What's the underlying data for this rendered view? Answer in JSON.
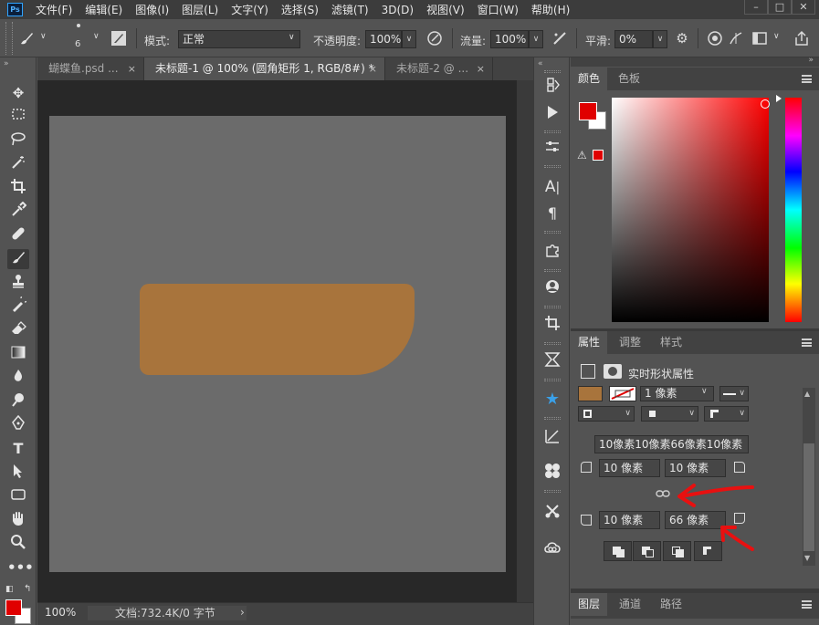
{
  "app": {
    "logo": "Ps"
  },
  "menu": [
    "文件(F)",
    "编辑(E)",
    "图像(I)",
    "图层(L)",
    "文字(Y)",
    "选择(S)",
    "滤镜(T)",
    "3D(D)",
    "视图(V)",
    "窗口(W)",
    "帮助(H)"
  ],
  "window_controls": {
    "minimize": "–",
    "maximize": "□",
    "close": "✕"
  },
  "options": {
    "brush_size": "6",
    "mode_label": "模式:",
    "mode_value": "正常",
    "opacity_label": "不透明度:",
    "opacity_value": "100%",
    "flow_label": "流量:",
    "flow_value": "100%",
    "smoothing_label": "平滑:",
    "smoothing_value": "0%"
  },
  "tabs": [
    {
      "label": "蝴蝶鱼.psd ...",
      "close": "×"
    },
    {
      "label": "未标题-1 @ 100% (圆角矩形 1, RGB/8#) *",
      "close": "×"
    },
    {
      "label": "未标题-2 @ ...",
      "close": "×"
    }
  ],
  "canvas": {
    "shape_color": "#a8743c",
    "document_color": "#6b6b6b"
  },
  "status": {
    "zoom": "100%",
    "doc_info": "文档:732.4K/0 字节",
    "arrow": "›"
  },
  "colors": {
    "foreground": "#e00000",
    "background": "#ffffff",
    "accent_red": "#e00000"
  },
  "color_panel": {
    "tabs": [
      "颜色",
      "色板"
    ],
    "warn_icon": "⚠"
  },
  "properties_panel": {
    "tabs": [
      "属性",
      "调整",
      "样式"
    ],
    "title": "实时形状属性",
    "stroke_width": "1 像素",
    "corners_summary": "10像素10像素66像素10像素",
    "corner_tl": "10 像素",
    "corner_tr": "10 像素",
    "corner_bl": "10 像素",
    "corner_br": "66 像素",
    "fill_color": "#a8743c"
  },
  "layers_panel": {
    "tabs": [
      "图层",
      "通道",
      "路径"
    ]
  },
  "icons": {
    "tools": [
      "move-icon",
      "marquee-icon",
      "lasso-icon",
      "magic-wand-icon",
      "crop-icon",
      "eyedropper-icon",
      "healing-icon",
      "brush-icon",
      "stamp-icon",
      "history-brush-icon",
      "eraser-icon",
      "gradient-icon",
      "blur-icon",
      "dodge-icon",
      "pen-icon",
      "type-icon",
      "path-select-icon",
      "rectangle-icon",
      "hand-icon",
      "zoom-icon",
      "more-icon"
    ]
  }
}
